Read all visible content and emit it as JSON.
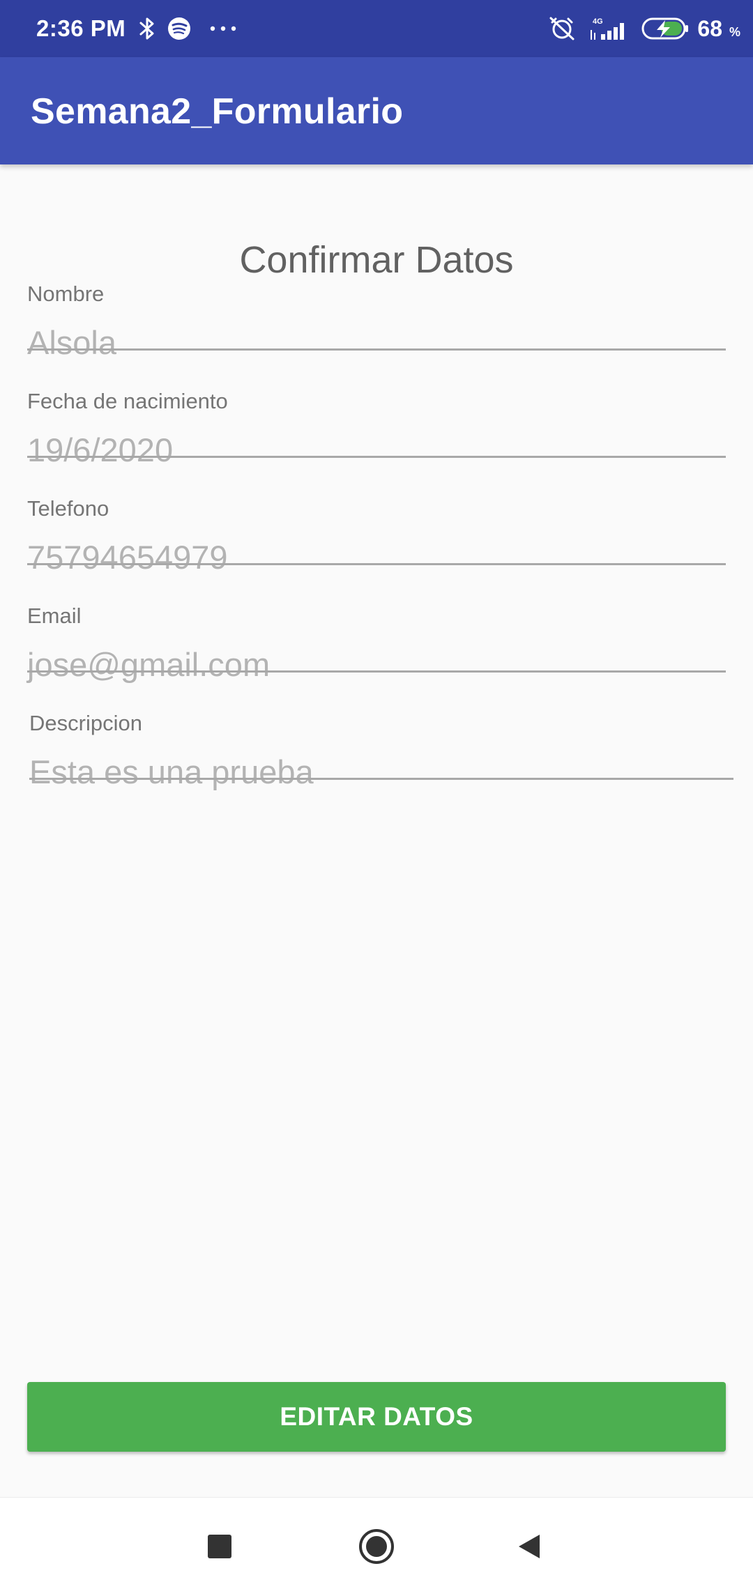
{
  "status_bar": {
    "time": "2:36 PM",
    "battery_level": "68",
    "battery_unit": "%",
    "network": "4G",
    "icons": [
      "bluetooth-icon",
      "spotify-icon",
      "more-notifications-icon",
      "alarm-off-icon",
      "signal-icon",
      "battery-charging-icon"
    ]
  },
  "app_bar": {
    "title": "Semana2_Formulario"
  },
  "form": {
    "heading": "Confirmar Datos",
    "fields": [
      {
        "label": "Nombre",
        "value": "Alsola"
      },
      {
        "label": "Fecha de nacimiento",
        "value": "19/6/2020"
      },
      {
        "label": "Telefono",
        "value": "75794654979"
      },
      {
        "label": "Email",
        "value": "jose@gmail.com"
      },
      {
        "label": "Descripcion",
        "value": "Esta es una prueba"
      }
    ]
  },
  "actions": {
    "edit_label": "EDITAR DATOS"
  },
  "nav": {
    "icons": [
      "recents-square-icon",
      "home-circle-icon",
      "back-triangle-icon"
    ]
  },
  "colors": {
    "status_bar": "#303f9f",
    "app_bar": "#3f51b5",
    "button": "#4caf50",
    "background": "#fafafa"
  }
}
